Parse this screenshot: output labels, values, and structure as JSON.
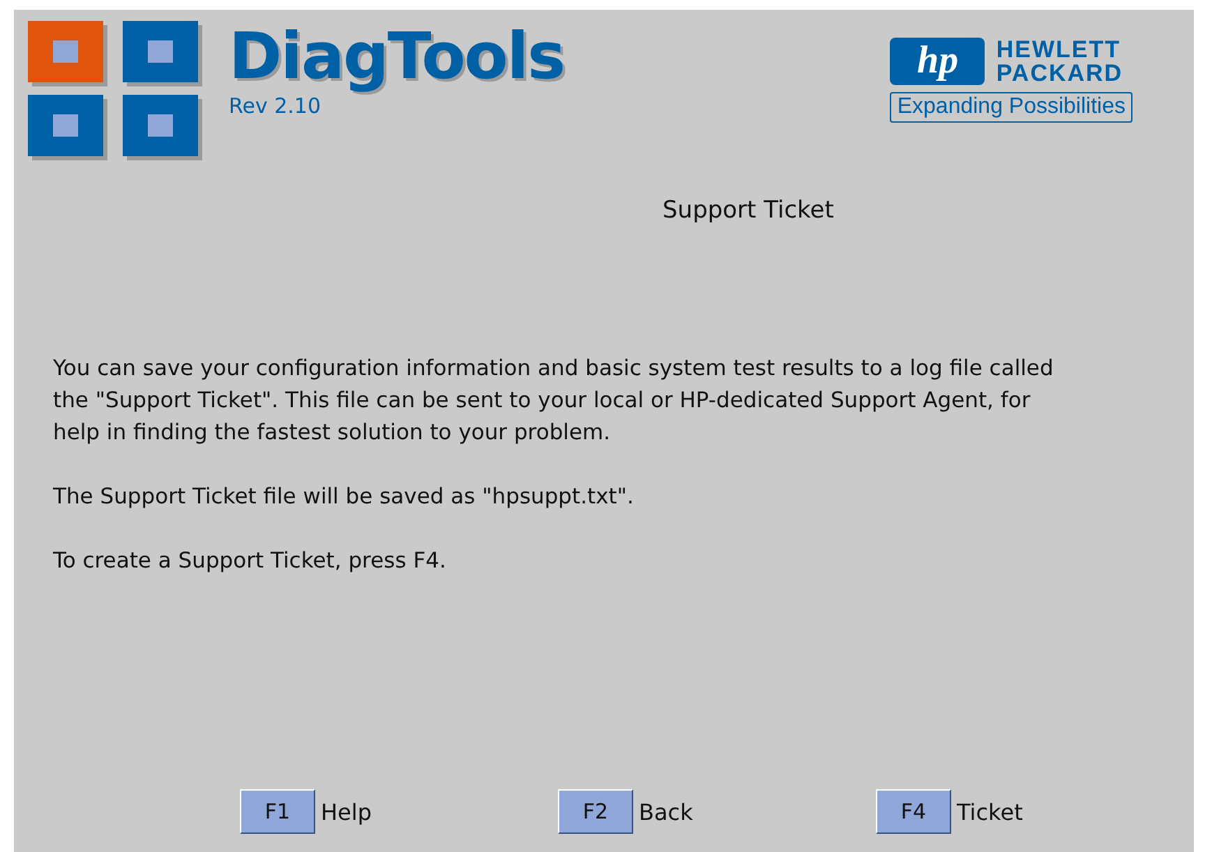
{
  "header": {
    "title": "DiagTools",
    "revision": "Rev 2.10"
  },
  "brand": {
    "logo_text": "hp",
    "name_lines": [
      "HEWLETT",
      "PACKARD"
    ],
    "tagline": "Expanding Possibilities"
  },
  "heading": "Support Ticket",
  "paragraphs": [
    "You can save your configuration information and basic system test results to a log file called the \"Support Ticket\". This file can be sent to your local or HP-dedicated Support Agent, for help in finding the fastest solution to your problem.",
    "The Support Ticket file will be saved as \"hpsuppt.txt\".",
    "To create a Support Ticket, press F4."
  ],
  "keys": [
    {
      "key": "F1",
      "label": "Help"
    },
    {
      "key": "F2",
      "label": "Back"
    },
    {
      "key": "F4",
      "label": "Ticket"
    }
  ]
}
